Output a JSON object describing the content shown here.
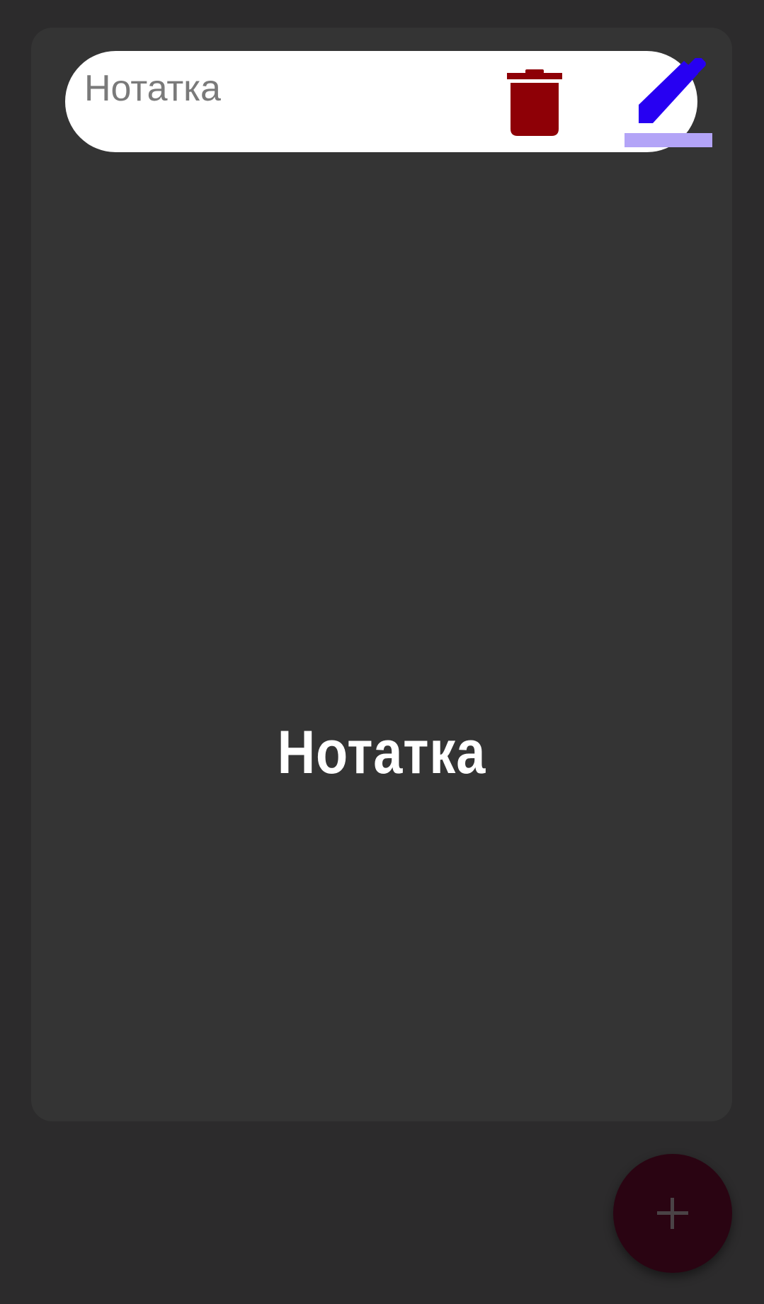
{
  "note": {
    "title_input": {
      "placeholder": "Нотатка",
      "value": ""
    },
    "display_title": "Нотатка",
    "actions": {
      "delete_icon": "trash-icon",
      "edit_icon": "pencil-icon"
    }
  },
  "fab": {
    "icon": "plus-icon"
  },
  "colors": {
    "background": "#2c2b2c",
    "card": "#343434",
    "delete": "#8e0006",
    "edit": "#2700f2",
    "edit_underline": "#b3a4f7",
    "fab": "#2a0412"
  }
}
